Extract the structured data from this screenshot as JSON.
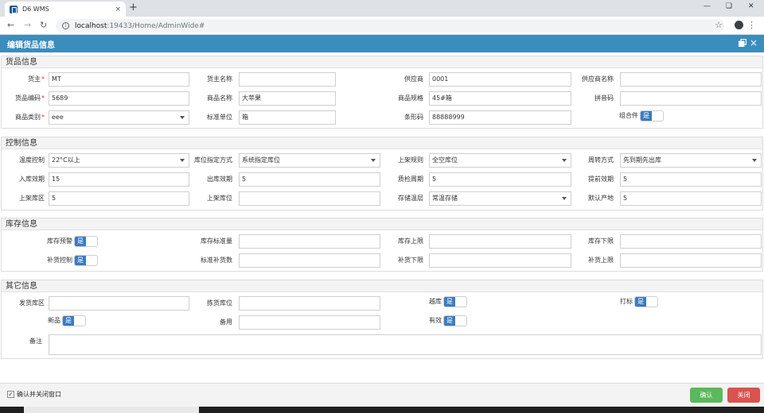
{
  "browser": {
    "tab_title": "D6 WMS",
    "tab_close": "×",
    "new_tab": "+",
    "url_host": "localhost",
    "url_path": ":19433/Home/AdminWide#"
  },
  "dialog": {
    "title": "编辑货品信息",
    "close_glyph": "×"
  },
  "sections": {
    "goods": {
      "title": "货品信息",
      "owner_label": "货主",
      "owner_value": "MT",
      "owner_name_label": "货主名称",
      "owner_name_value": "",
      "supplier_label": "供应商",
      "supplier_value": "0001",
      "supplier_name_label": "供应商名称",
      "supplier_name_value": "",
      "code_label": "货品编码",
      "code_value": "5689",
      "product_name_label": "商品名称",
      "product_name_value": "大苹果",
      "spec_label": "商品规格",
      "spec_value": "45#箱",
      "pinyin_label": "拼音码",
      "pinyin_value": "",
      "category_label": "商品类别",
      "category_value": "eee",
      "unit_label": "标准单位",
      "unit_value": "箱",
      "barcode_label": "条形码",
      "barcode_value": "88888999",
      "combo_label": "组合件",
      "combo_toggle": "是"
    },
    "control": {
      "title": "控制信息",
      "temp_label": "温度控制",
      "temp_value": "22°C以上",
      "loc_mode_label": "库位指定方式",
      "loc_mode_value": "系统指定库位",
      "putaway_rule_label": "上架规则",
      "putaway_rule_value": "全空库位",
      "turnover_label": "周转方式",
      "turnover_value": "先到期先出库",
      "in_eff_label": "入库效期",
      "in_eff_value": "15",
      "out_eff_label": "出库效期",
      "out_eff_value": "5",
      "qc_label": "质检周期",
      "qc_value": "5",
      "advance_label": "提前效期",
      "advance_value": "5",
      "putaway_area_label": "上架库区",
      "putaway_area_value": "5",
      "putaway_loc_label": "上架库位",
      "putaway_loc_value": "",
      "storage_temp_label": "存储温层",
      "storage_temp_value": "常温存储",
      "origin_label": "默认产地",
      "origin_value": "5"
    },
    "stock": {
      "title": "库存信息",
      "warn_label": "库存预警",
      "warn_toggle": "是",
      "std_qty_label": "库存标准量",
      "std_qty_value": "",
      "upper_label": "库存上限",
      "upper_value": "",
      "lower_label": "库存下限",
      "lower_value": "",
      "replenish_label": "补货控制",
      "replenish_toggle": "是",
      "std_replenish_label": "标准补货数",
      "std_replenish_value": "",
      "rep_lower_label": "补货下限",
      "rep_lower_value": "",
      "rep_upper_label": "补货上限",
      "rep_upper_value": ""
    },
    "other": {
      "title": "其它信息",
      "ship_area_label": "发货库区",
      "ship_area_value": "",
      "pick_loc_label": "拣货库位",
      "pick_loc_value": "",
      "cross_label": "越库",
      "cross_toggle": "是",
      "label_print_label": "打标",
      "label_print_toggle": "是",
      "new_label": "新品",
      "new_toggle": "是",
      "spare_label": "备用",
      "spare_value": "",
      "valid_label": "有效",
      "valid_toggle": "是",
      "remark_label": "备注",
      "remark_value": ""
    }
  },
  "footer": {
    "confirm_close_label": "确认并关闭窗口",
    "confirm_button": "确认",
    "close_button": "关闭"
  }
}
